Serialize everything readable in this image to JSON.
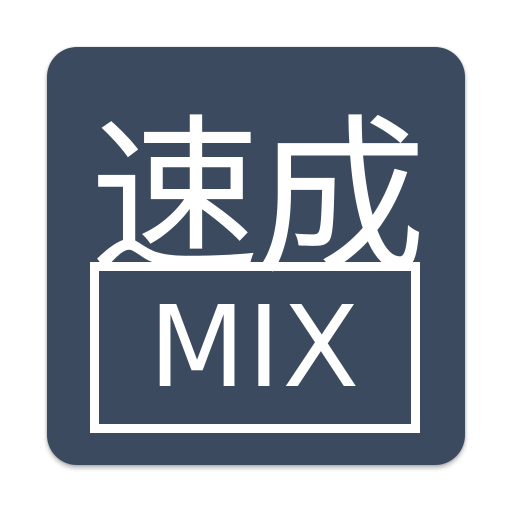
{
  "icon": {
    "background_color": "#3b4a5e",
    "foreground_color": "#ffffff",
    "title": "速成",
    "boxed_label": "MIX"
  }
}
